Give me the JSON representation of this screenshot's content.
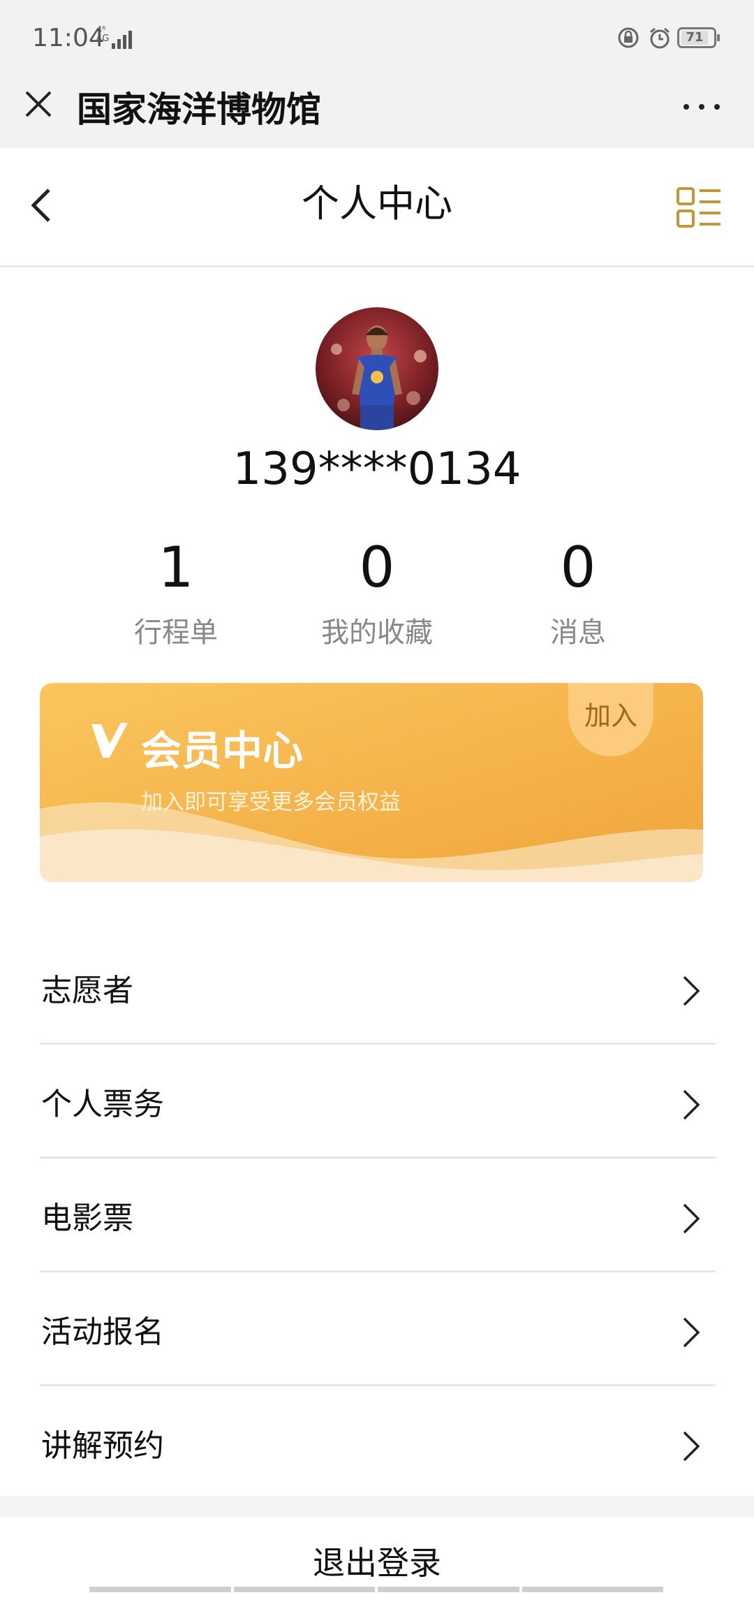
{
  "status_bar": {
    "time": "11:04",
    "network": "4G",
    "network_sup": "4⁶",
    "battery": "71"
  },
  "wechat_header": {
    "title": "国家海洋博物馆",
    "close_icon": "close-icon",
    "more_icon": "more-icon"
  },
  "nav": {
    "title": "个人中心",
    "back_icon": "back-arrow-icon",
    "menu_icon": "grid-list-icon"
  },
  "profile": {
    "phone": "139****0134",
    "stats": [
      {
        "value": "1",
        "label": "行程单"
      },
      {
        "value": "0",
        "label": "我的收藏"
      },
      {
        "value": "0",
        "label": "消息"
      }
    ]
  },
  "member_card": {
    "title": "会员中心",
    "subtitle": "加入即可享受更多会员权益",
    "join_label": "加入",
    "colors": {
      "start": "#fbc65e",
      "end": "#f1a83a"
    }
  },
  "menu": {
    "items": [
      {
        "label": "志愿者"
      },
      {
        "label": "个人票务"
      },
      {
        "label": "电影票"
      },
      {
        "label": "活动报名"
      },
      {
        "label": "讲解预约"
      }
    ]
  },
  "logout_label": "退出登录",
  "accent": "#c49638"
}
